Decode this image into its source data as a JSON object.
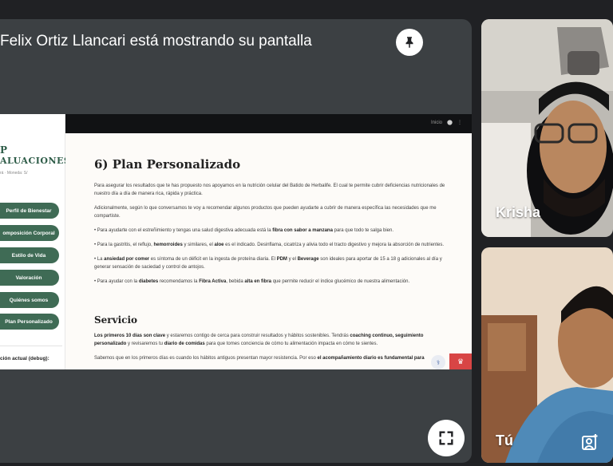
{
  "meeting": {
    "presenting_banner": "Felix Ortiz Llancari está mostrando su pantalla",
    "pin_icon": "pin-icon",
    "fullscreen_icon": "fullscreen-icon"
  },
  "shared_screen": {
    "brand_line1": "P",
    "brand_line2": "ALUACIONES",
    "brand_sub": "rá · Moneda: S/",
    "nav_items": [
      {
        "label": "Perfil de Bienestar"
      },
      {
        "label": "omposición Corporal"
      },
      {
        "label": "Estilo de Vida"
      },
      {
        "label": "Valoración"
      },
      {
        "label": "Quiénes somos"
      },
      {
        "label": "Plan Personalizado"
      }
    ],
    "debug_label": "ción actual (debug):",
    "topbar_links": [
      "Inicio",
      "GitHub"
    ],
    "section1_title": "6) Plan Personalizado",
    "p1": "Para asegurar los resultados que te has propuesto nos apoyamos en la nutrición celular del Batido de Herbalife. El cual te permite cubrir deficiencias nutricionales de nuestro día a día de manera rica, rápida y práctica.",
    "p2": "Adicionalmente, según lo que conversamos te voy a recomendar algunos productos que pueden ayudarte a cubrir de manera específica las necesidades que me compartiste.",
    "b1_pre": "• Para ayudarte con el estreñimiento y tengas una salud digestiva adecuada está la ",
    "b1_bold": "fibra con sabor a manzana",
    "b1_post": " para que todo te salga bien.",
    "b2_pre": "• Para la gastritis, el reflujo, ",
    "b2_bold1": "hemorroides",
    "b2_mid": " y similares, el ",
    "b2_bold2": "aloe",
    "b2_post": " es el indicado. Desinflama, cicatriza y alivia todo el tracto digestivo y mejora la absorción de nutrientes.",
    "b3_pre": "• La ",
    "b3_bold1": "ansiedad por comer",
    "b3_mid1": " es síntoma de un déficit en la ingesta de proteína diaria. El ",
    "b3_bold2": "PDM",
    "b3_mid2": " y el ",
    "b3_bold3": "Beverage",
    "b3_post": " son ideales para aportar de 15 a 18 g adicionales al día y generar sensación de saciedad y control de antojos.",
    "b4_pre": "• Para ayudar con la ",
    "b4_bold1": "diabetes",
    "b4_mid1": " recomendamos la ",
    "b4_bold2": "Fibra Activa",
    "b4_mid2": ", bebida ",
    "b4_bold3": "alta en fibra",
    "b4_post": " que permite reducir el índice glucémico de nuestra alimentación.",
    "section2_title": "Servicio",
    "s1_bold1": "Los primeros 10 días son clave",
    "s1_mid1": " y estaremos contigo de cerca para construir resultados y hábitos sostenibles. Tendrás ",
    "s1_bold2": "coaching continuo, seguimiento personalizado",
    "s1_mid2": " y revisaremos tu ",
    "s1_bold3": "diario de comidas",
    "s1_post": " para que tomes conciencia de cómo tu alimentación impacta en cómo te sientes.",
    "s2_pre": "Sabemos que en los primeros días es cuando los hábitos antiguos presentan mayor resistencia. Por eso ",
    "s2_bold": "el acompañamiento diario es fundamental para"
  },
  "participants": [
    {
      "name": "Krisha"
    },
    {
      "name": "Tú"
    }
  ],
  "colors": {
    "meet_bg": "#202124",
    "tile_bg": "#3c4043",
    "nav_green": "#3f6b55",
    "brand_green": "#2e5c48"
  }
}
